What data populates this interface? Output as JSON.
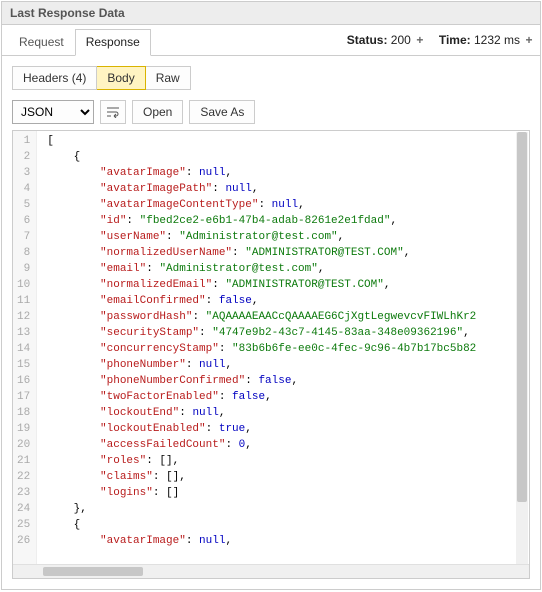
{
  "panel": {
    "title": "Last Response Data"
  },
  "tabs": {
    "request": "Request",
    "response": "Response"
  },
  "status": {
    "label": "Status:",
    "value": "200"
  },
  "time": {
    "label": "Time:",
    "value": "1232 ms"
  },
  "viewTabs": {
    "headers": "Headers (4)",
    "body": "Body",
    "raw": "Raw"
  },
  "toolbar": {
    "format": "JSON",
    "open": "Open",
    "saveAs": "Save As"
  },
  "json": {
    "lines": [
      {
        "indent": 0,
        "tokens": [
          [
            "p",
            "["
          ]
        ]
      },
      {
        "indent": 1,
        "tokens": [
          [
            "p",
            "{"
          ]
        ]
      },
      {
        "indent": 2,
        "tokens": [
          [
            "k",
            "\"avatarImage\""
          ],
          [
            "p",
            ": "
          ],
          [
            "n",
            "null"
          ],
          [
            "p",
            ","
          ]
        ]
      },
      {
        "indent": 2,
        "tokens": [
          [
            "k",
            "\"avatarImagePath\""
          ],
          [
            "p",
            ": "
          ],
          [
            "n",
            "null"
          ],
          [
            "p",
            ","
          ]
        ]
      },
      {
        "indent": 2,
        "tokens": [
          [
            "k",
            "\"avatarImageContentType\""
          ],
          [
            "p",
            ": "
          ],
          [
            "n",
            "null"
          ],
          [
            "p",
            ","
          ]
        ]
      },
      {
        "indent": 2,
        "tokens": [
          [
            "k",
            "\"id\""
          ],
          [
            "p",
            ": "
          ],
          [
            "s",
            "\"fbed2ce2-e6b1-47b4-adab-8261e2e1fdad\""
          ],
          [
            "p",
            ","
          ]
        ]
      },
      {
        "indent": 2,
        "tokens": [
          [
            "k",
            "\"userName\""
          ],
          [
            "p",
            ": "
          ],
          [
            "s",
            "\"Administrator@test.com\""
          ],
          [
            "p",
            ","
          ]
        ]
      },
      {
        "indent": 2,
        "tokens": [
          [
            "k",
            "\"normalizedUserName\""
          ],
          [
            "p",
            ": "
          ],
          [
            "s",
            "\"ADMINISTRATOR@TEST.COM\""
          ],
          [
            "p",
            ","
          ]
        ]
      },
      {
        "indent": 2,
        "tokens": [
          [
            "k",
            "\"email\""
          ],
          [
            "p",
            ": "
          ],
          [
            "s",
            "\"Administrator@test.com\""
          ],
          [
            "p",
            ","
          ]
        ]
      },
      {
        "indent": 2,
        "tokens": [
          [
            "k",
            "\"normalizedEmail\""
          ],
          [
            "p",
            ": "
          ],
          [
            "s",
            "\"ADMINISTRATOR@TEST.COM\""
          ],
          [
            "p",
            ","
          ]
        ]
      },
      {
        "indent": 2,
        "tokens": [
          [
            "k",
            "\"emailConfirmed\""
          ],
          [
            "p",
            ": "
          ],
          [
            "n",
            "false"
          ],
          [
            "p",
            ","
          ]
        ]
      },
      {
        "indent": 2,
        "tokens": [
          [
            "k",
            "\"passwordHash\""
          ],
          [
            "p",
            ": "
          ],
          [
            "s",
            "\"AQAAAAEAACcQAAAAEG6CjXgtLegwevcvFIWLhKr2"
          ]
        ]
      },
      {
        "indent": 2,
        "tokens": [
          [
            "k",
            "\"securityStamp\""
          ],
          [
            "p",
            ": "
          ],
          [
            "s",
            "\"4747e9b2-43c7-4145-83aa-348e09362196\""
          ],
          [
            "p",
            ","
          ]
        ]
      },
      {
        "indent": 2,
        "tokens": [
          [
            "k",
            "\"concurrencyStamp\""
          ],
          [
            "p",
            ": "
          ],
          [
            "s",
            "\"83b6b6fe-ee0c-4fec-9c96-4b7b17bc5b82"
          ]
        ]
      },
      {
        "indent": 2,
        "tokens": [
          [
            "k",
            "\"phoneNumber\""
          ],
          [
            "p",
            ": "
          ],
          [
            "n",
            "null"
          ],
          [
            "p",
            ","
          ]
        ]
      },
      {
        "indent": 2,
        "tokens": [
          [
            "k",
            "\"phoneNumberConfirmed\""
          ],
          [
            "p",
            ": "
          ],
          [
            "n",
            "false"
          ],
          [
            "p",
            ","
          ]
        ]
      },
      {
        "indent": 2,
        "tokens": [
          [
            "k",
            "\"twoFactorEnabled\""
          ],
          [
            "p",
            ": "
          ],
          [
            "n",
            "false"
          ],
          [
            "p",
            ","
          ]
        ]
      },
      {
        "indent": 2,
        "tokens": [
          [
            "k",
            "\"lockoutEnd\""
          ],
          [
            "p",
            ": "
          ],
          [
            "n",
            "null"
          ],
          [
            "p",
            ","
          ]
        ]
      },
      {
        "indent": 2,
        "tokens": [
          [
            "k",
            "\"lockoutEnabled\""
          ],
          [
            "p",
            ": "
          ],
          [
            "n",
            "true"
          ],
          [
            "p",
            ","
          ]
        ]
      },
      {
        "indent": 2,
        "tokens": [
          [
            "k",
            "\"accessFailedCount\""
          ],
          [
            "p",
            ": "
          ],
          [
            "n",
            "0"
          ],
          [
            "p",
            ","
          ]
        ]
      },
      {
        "indent": 2,
        "tokens": [
          [
            "k",
            "\"roles\""
          ],
          [
            "p",
            ": []"
          ],
          [
            "p",
            ","
          ]
        ]
      },
      {
        "indent": 2,
        "tokens": [
          [
            "k",
            "\"claims\""
          ],
          [
            "p",
            ": []"
          ],
          [
            "p",
            ","
          ]
        ]
      },
      {
        "indent": 2,
        "tokens": [
          [
            "k",
            "\"logins\""
          ],
          [
            "p",
            ": []"
          ]
        ]
      },
      {
        "indent": 1,
        "tokens": [
          [
            "p",
            "},"
          ]
        ]
      },
      {
        "indent": 1,
        "tokens": [
          [
            "p",
            "{"
          ]
        ]
      },
      {
        "indent": 2,
        "tokens": [
          [
            "k",
            "\"avatarImage\""
          ],
          [
            "p",
            ": "
          ],
          [
            "n",
            "null"
          ],
          [
            "p",
            ","
          ]
        ]
      }
    ]
  }
}
